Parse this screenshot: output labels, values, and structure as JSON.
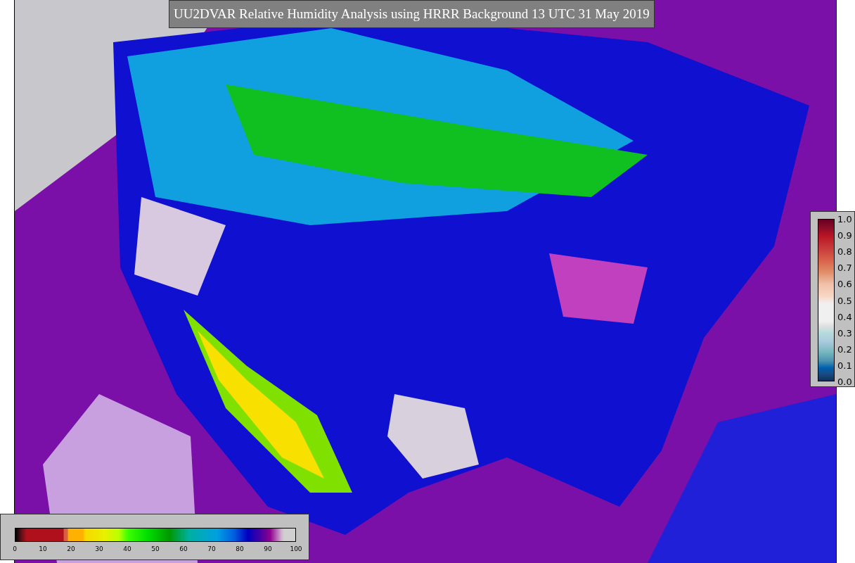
{
  "title": "UU2DVAR Relative Humidity Analysis using HRRR Background 13 UTC 31 May 2019",
  "humidity_legend": {
    "ticks": [
      "0",
      "10",
      "20",
      "30",
      "40",
      "50",
      "60",
      "70",
      "80",
      "90",
      "100"
    ]
  },
  "error_legend": {
    "ticks": [
      "1.0",
      "0.9",
      "0.8",
      "0.7",
      "0.6",
      "0.5",
      "0.4",
      "0.3",
      "0.2",
      "0.1",
      "0.0"
    ]
  }
}
